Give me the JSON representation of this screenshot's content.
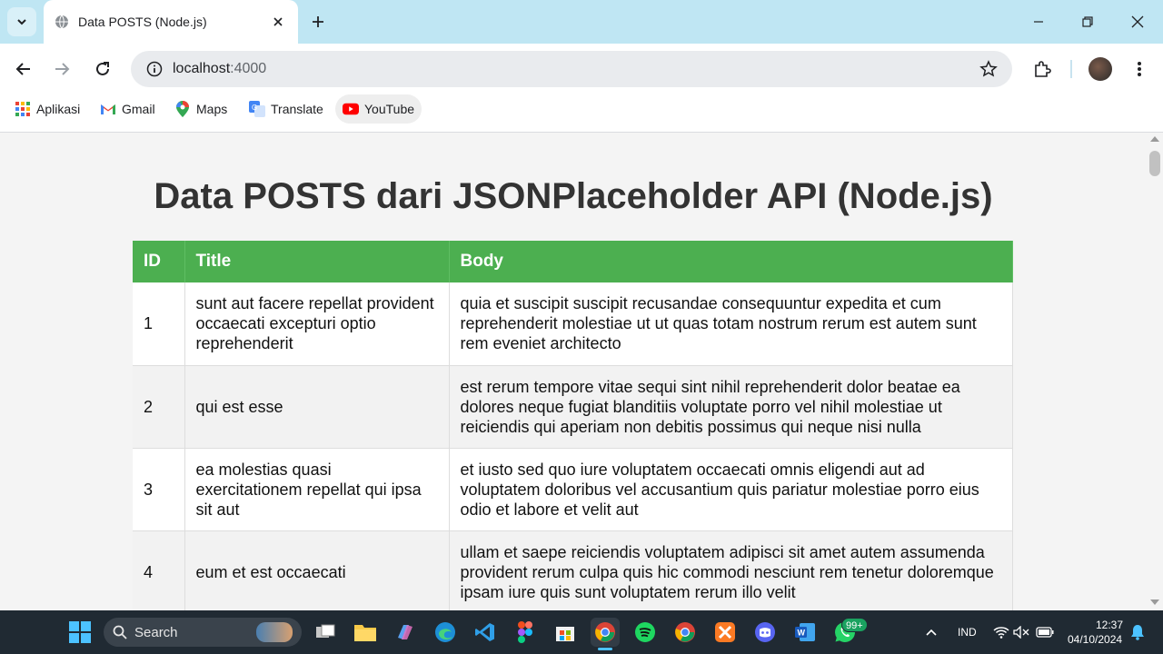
{
  "browser": {
    "tab": {
      "title": "Data POSTS (Node.js)"
    },
    "omnibox": {
      "host": "localhost",
      "port": ":4000"
    },
    "bookmarks": [
      {
        "label": "Aplikasi",
        "icon": "apps-grid-icon"
      },
      {
        "label": "Gmail",
        "icon": "gmail-icon"
      },
      {
        "label": "Maps",
        "icon": "maps-icon"
      },
      {
        "label": "Translate",
        "icon": "translate-icon"
      },
      {
        "label": "YouTube",
        "icon": "youtube-icon"
      }
    ]
  },
  "page": {
    "title": "Data POSTS dari JSONPlaceholder API (Node.js)",
    "table": {
      "headers": [
        "ID",
        "Title",
        "Body"
      ],
      "rows": [
        {
          "id": "1",
          "title": "sunt aut facere repellat provident occaecati excepturi optio reprehenderit",
          "body": "quia et suscipit suscipit recusandae consequuntur expedita et cum reprehenderit molestiae ut ut quas totam nostrum rerum est autem sunt rem eveniet architecto"
        },
        {
          "id": "2",
          "title": "qui est esse",
          "body": "est rerum tempore vitae sequi sint nihil reprehenderit dolor beatae ea dolores neque fugiat blanditiis voluptate porro vel nihil molestiae ut reiciendis qui aperiam non debitis possimus qui neque nisi nulla"
        },
        {
          "id": "3",
          "title": "ea molestias quasi exercitationem repellat qui ipsa sit aut",
          "body": "et iusto sed quo iure voluptatem occaecati omnis eligendi aut ad voluptatem doloribus vel accusantium quis pariatur molestiae porro eius odio et labore et velit aut"
        },
        {
          "id": "4",
          "title": "eum et est occaecati",
          "body": "ullam et saepe reiciendis voluptatem adipisci sit amet autem assumenda provident rerum culpa quis hic commodi nesciunt rem tenetur doloremque ipsam iure quis sunt voluptatem rerum illo velit"
        }
      ]
    }
  },
  "taskbar": {
    "search_label": "Search",
    "notification_badge": "99+",
    "language": "IND",
    "time": "12:37",
    "date": "04/10/2024"
  },
  "colors": {
    "table_header": "#4caf50",
    "tabstrip": "#bfe6f3",
    "taskbar": "#202a33"
  }
}
